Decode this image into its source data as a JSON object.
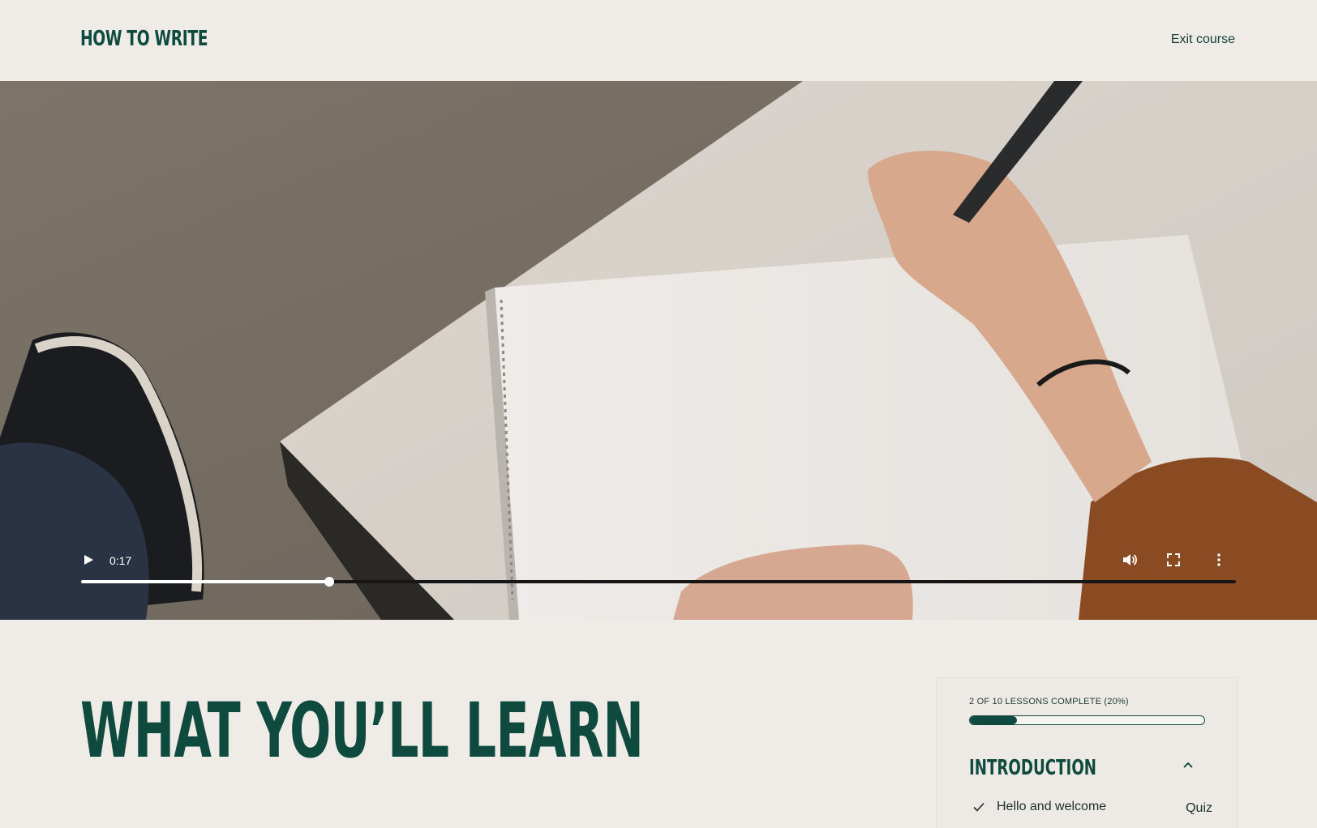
{
  "header": {
    "brand": "HOW TO WRITE",
    "exit_label": "Exit course"
  },
  "video": {
    "current_time": "0:17",
    "progress_fraction": 0.215,
    "icons": {
      "play": "play-icon",
      "volume": "volume-icon",
      "fullscreen": "fullscreen-icon",
      "more": "more-vertical-icon"
    }
  },
  "main": {
    "heading": "WHAT YOU’LL LEARN"
  },
  "course_panel": {
    "progress_label": "2 of 10 lessons complete (20%)",
    "progress_fraction": 0.2,
    "section": {
      "title": "INTRODUCTION",
      "expanded": true,
      "lessons": [
        {
          "title": "Hello and welcome",
          "type": "Quiz",
          "completed": true
        }
      ]
    }
  },
  "colors": {
    "brand_green": "#0f4a3e",
    "background": "#efece7"
  }
}
